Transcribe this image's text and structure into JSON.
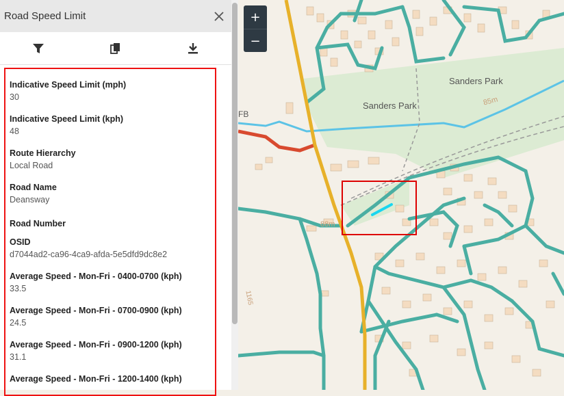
{
  "panel": {
    "title": "Road Speed Limit",
    "tools": [
      {
        "name": "filter-icon"
      },
      {
        "name": "copy-icon"
      },
      {
        "name": "download-icon"
      }
    ]
  },
  "attributes": [
    {
      "label": "Indicative Speed Limit (mph)",
      "value": "30"
    },
    {
      "label": "Indicative Speed Limit (kph)",
      "value": "48"
    },
    {
      "label": "Route Hierarchy",
      "value": "Local Road"
    },
    {
      "label": "Road Name",
      "value": "Deansway"
    },
    {
      "label": "Road Number",
      "value": ""
    },
    {
      "label": "OSID",
      "value": "d7044ad2-ca96-4ca9-afda-5e5dfd9dc8e2"
    },
    {
      "label": "Average Speed - Mon-Fri - 0400-0700 (kph)",
      "value": "33.5"
    },
    {
      "label": "Average Speed - Mon-Fri - 0700-0900 (kph)",
      "value": "24.5"
    },
    {
      "label": "Average Speed - Mon-Fri - 0900-1200 (kph)",
      "value": "31.1"
    },
    {
      "label": "Average Speed - Mon-Fri - 1200-1400 (kph)",
      "value": ""
    }
  ],
  "map": {
    "labels": {
      "park1": "Sanders Park",
      "park2": "Sanders Park",
      "contour1": "85m",
      "contour2": "88m",
      "fb": "FB",
      "road": "1165"
    },
    "zoom_in": "+",
    "zoom_out": "−",
    "colors": {
      "local_road": "#4aaea2",
      "a_road": "#e7b12a",
      "b_road": "#d84a2f",
      "water": "#5cc3e6",
      "park": "#dcebd3",
      "selected": "#19d6ef"
    }
  }
}
